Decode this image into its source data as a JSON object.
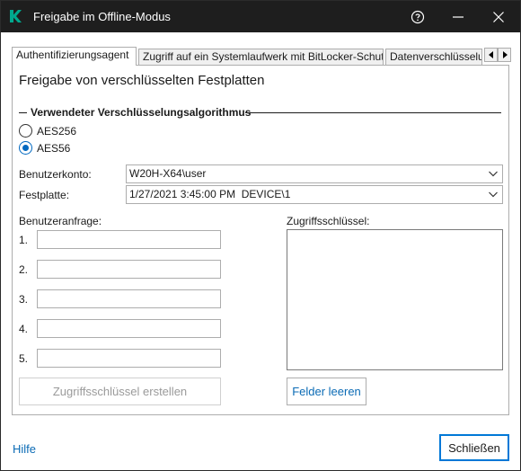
{
  "window": {
    "title": "Freigabe im Offline-Modus"
  },
  "tabs": [
    {
      "label": "Authentifizierungsagent",
      "active": true
    },
    {
      "label": "Zugriff auf ein Systemlaufwerk mit BitLocker-Schutz",
      "active": false
    },
    {
      "label": "Datenverschlüsselung",
      "active": false
    }
  ],
  "main": {
    "heading": "Freigabe von verschlüsselten Festplatten",
    "algorithm_section": "Verwendeter Verschlüsselungsalgorithmus",
    "algorithms": [
      {
        "label": "AES256",
        "selected": false
      },
      {
        "label": "AES56",
        "selected": true
      }
    ],
    "account_label": "Benutzerkonto:",
    "account_value": "W20H-X64\\user",
    "disk_label": "Festplatte:",
    "disk_value": "1/27/2021 3:45:00 PM  DEVICE\\1",
    "request_label": "Benutzeranfrage:",
    "request_fields": [
      {
        "number": "1.",
        "value": ""
      },
      {
        "number": "2.",
        "value": ""
      },
      {
        "number": "3.",
        "value": ""
      },
      {
        "number": "4.",
        "value": ""
      },
      {
        "number": "5.",
        "value": ""
      }
    ],
    "key_label": "Zugriffsschlüssel:",
    "key_value": "",
    "create_key_button": "Zugriffsschlüssel erstellen",
    "clear_fields_button": "Felder leeren"
  },
  "footer": {
    "help_link": "Hilfe",
    "close_button": "Schließen"
  },
  "colors": {
    "titlebar": "#1e1e1e",
    "accent": "#0068c0",
    "brand_logo": "#00a88e",
    "link": "#0b6bb5"
  },
  "icons": {
    "logo": "kaspersky-k-icon",
    "help": "question-circle-icon",
    "minimize": "minimize-icon",
    "close": "close-icon",
    "dropdown": "chevron-down-icon",
    "tab_scroll_left": "triangle-left-icon",
    "tab_scroll_right": "triangle-right-icon"
  }
}
